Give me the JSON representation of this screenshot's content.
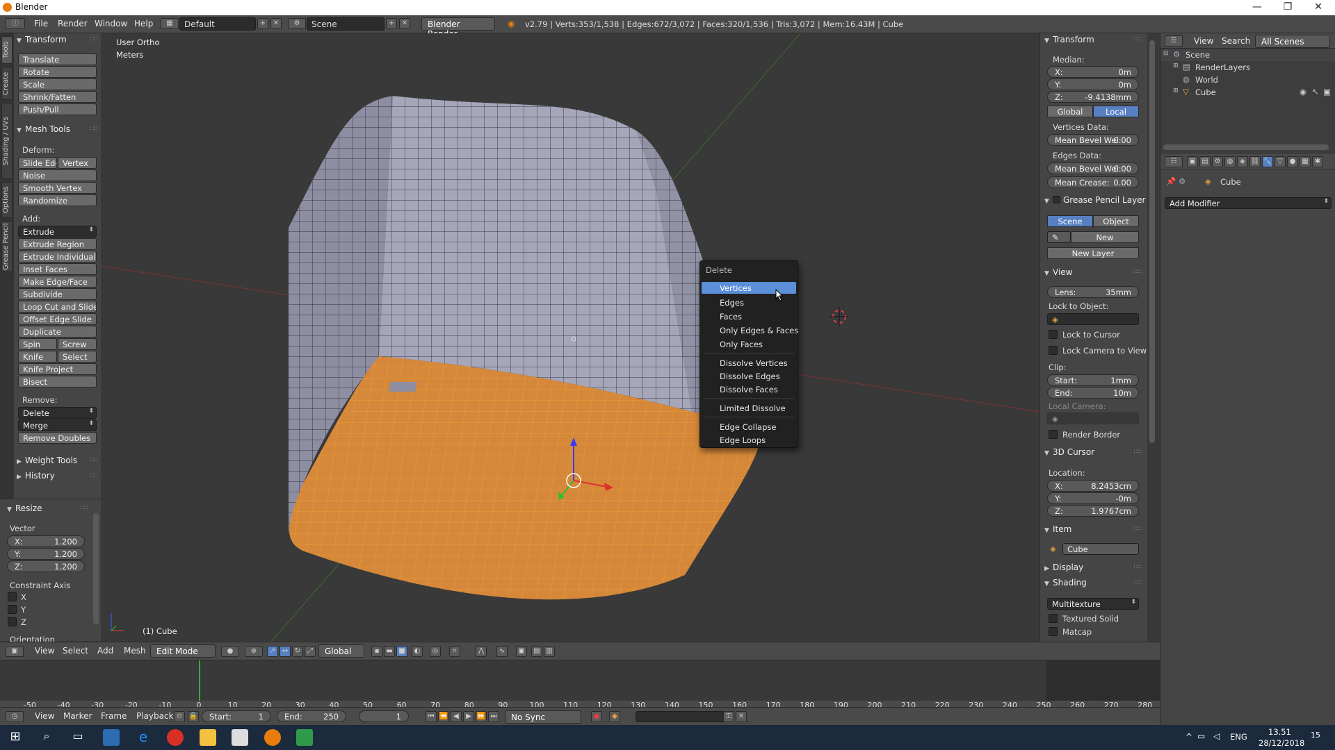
{
  "titlebar": {
    "title": "Blender",
    "minimize": "—",
    "maximize": "❐",
    "close": "✕"
  },
  "menubar": {
    "items": [
      "File",
      "Render",
      "Window",
      "Help"
    ],
    "layout": "Default",
    "scene": "Scene",
    "engine": "Blender Render",
    "stats": "v2.79 | Verts:353/1,538 | Edges:672/3,072 | Faces:320/1,536 | Tris:3,072 | Mem:16.43M | Cube"
  },
  "left_tabs": [
    "Tools",
    "Create",
    "Shading / UVs",
    "Options",
    "Grease Pencil"
  ],
  "tools": {
    "transform_header": "Transform",
    "transform": [
      "Translate",
      "Rotate",
      "Scale",
      "Shrink/Fatten",
      "Push/Pull"
    ],
    "mesh_tools_header": "Mesh Tools",
    "deform_label": "Deform:",
    "slide_edge": "Slide Edg",
    "vertex": "Vertex",
    "noise": "Noise",
    "smooth_vertex": "Smooth Vertex",
    "randomize": "Randomize",
    "add_label": "Add:",
    "extrude": "Extrude",
    "add_items": [
      "Extrude Region",
      "Extrude Individual",
      "Inset Faces",
      "Make Edge/Face",
      "Subdivide",
      "Loop Cut and Slide",
      "Offset Edge Slide",
      "Duplicate"
    ],
    "spin": "Spin",
    "screw": "Screw",
    "knife": "Knife",
    "select": "Select",
    "knife_project": "Knife Project",
    "bisect": "Bisect",
    "remove_label": "Remove:",
    "delete": "Delete",
    "merge": "Merge",
    "remove_doubles": "Remove Doubles",
    "weight_tools": "Weight Tools",
    "history": "History"
  },
  "operator": {
    "header": "Resize",
    "vector_label": "Vector",
    "x_label": "X:",
    "x": "1.200",
    "y_label": "Y:",
    "y": "1.200",
    "z_label": "Z:",
    "z": "1.200",
    "constraint_label": "Constraint Axis",
    "cx": "X",
    "cy": "Y",
    "cz": "Z",
    "orientation": "Orientation"
  },
  "viewport": {
    "view_name": "User Ortho",
    "units": "Meters",
    "object_label": "(1) Cube"
  },
  "context_menu": {
    "title": "Delete",
    "items_a": [
      "Vertices",
      "Edges",
      "Faces",
      "Only Edges & Faces",
      "Only Faces"
    ],
    "items_b": [
      "Dissolve Vertices",
      "Dissolve Edges",
      "Dissolve Faces"
    ],
    "items_c": [
      "Limited Dissolve"
    ],
    "items_d": [
      "Edge Collapse",
      "Edge Loops"
    ]
  },
  "npanel": {
    "transform": "Transform",
    "median": "Median:",
    "x_label": "X:",
    "x": "0m",
    "y_label": "Y:",
    "y": "0m",
    "z_label": "Z:",
    "z": "-9.4138mm",
    "global": "Global",
    "local": "Local",
    "vertices_data": "Vertices Data:",
    "mean_bevel_v": "Mean Bevel Wei:",
    "mean_bevel_v_val": "0.00",
    "edges_data": "Edges Data:",
    "mean_bevel_e": "Mean Bevel Wei:",
    "mean_bevel_e_val": "0.00",
    "mean_crease": "Mean Crease:",
    "mean_crease_val": "0.00",
    "grease_pencil": "Grease Pencil Layer",
    "scene": "Scene",
    "object": "Object",
    "new": "New",
    "new_layer": "New Layer",
    "view": "View",
    "lens": "Lens:",
    "lens_val": "35mm",
    "lock_to_object": "Lock to Object:",
    "lock_to_cursor": "Lock to Cursor",
    "lock_camera": "Lock Camera to View",
    "clip": "Clip:",
    "start": "Start:",
    "start_val": "1mm",
    "end": "End:",
    "end_val": "10m",
    "local_camera": "Local Camera:",
    "render_border": "Render Border",
    "cursor": "3D Cursor",
    "location": "Location:",
    "cx_label": "X:",
    "cx": "8.2453cm",
    "cy_label": "Y:",
    "cy": "-0m",
    "cz_label": "Z:",
    "cz": "1.9767cm",
    "item": "Item",
    "item_name": "Cube",
    "display": "Display",
    "shading": "Shading",
    "multitexture": "Multitexture",
    "textured_solid": "Textured Solid",
    "matcap": "Matcap"
  },
  "outliner": {
    "view": "View",
    "search": "Search",
    "all_scenes": "All Scenes",
    "scene": "Scene",
    "render_layers": "RenderLayers",
    "world": "World",
    "cube": "Cube"
  },
  "properties": {
    "object": "Cube",
    "add_modifier": "Add Modifier"
  },
  "view3d_header": {
    "view": "View",
    "select": "Select",
    "add": "Add",
    "mesh": "Mesh",
    "mode": "Edit Mode",
    "orientation": "Global"
  },
  "timeline": {
    "ticks": [
      "-50",
      "-40",
      "-30",
      "-20",
      "-10",
      "0",
      "10",
      "20",
      "30",
      "40",
      "50",
      "60",
      "70",
      "80",
      "90",
      "100",
      "110",
      "120",
      "130",
      "140",
      "150",
      "160",
      "170",
      "180",
      "190",
      "200",
      "210",
      "220",
      "230",
      "240",
      "250",
      "260",
      "270",
      "280"
    ],
    "view": "View",
    "marker": "Marker",
    "frame": "Frame",
    "playback": "Playback",
    "start_label": "Start:",
    "start": "1",
    "end_label": "End:",
    "end": "250",
    "current": "1",
    "sync": "No Sync"
  },
  "taskbar": {
    "lang": "ENG",
    "time": "13.51",
    "date": "28/12/2018",
    "notif": "15"
  },
  "colors": {
    "selection": "#f0a030",
    "accent": "#5680c2",
    "highlight": "#5b8fd9"
  }
}
